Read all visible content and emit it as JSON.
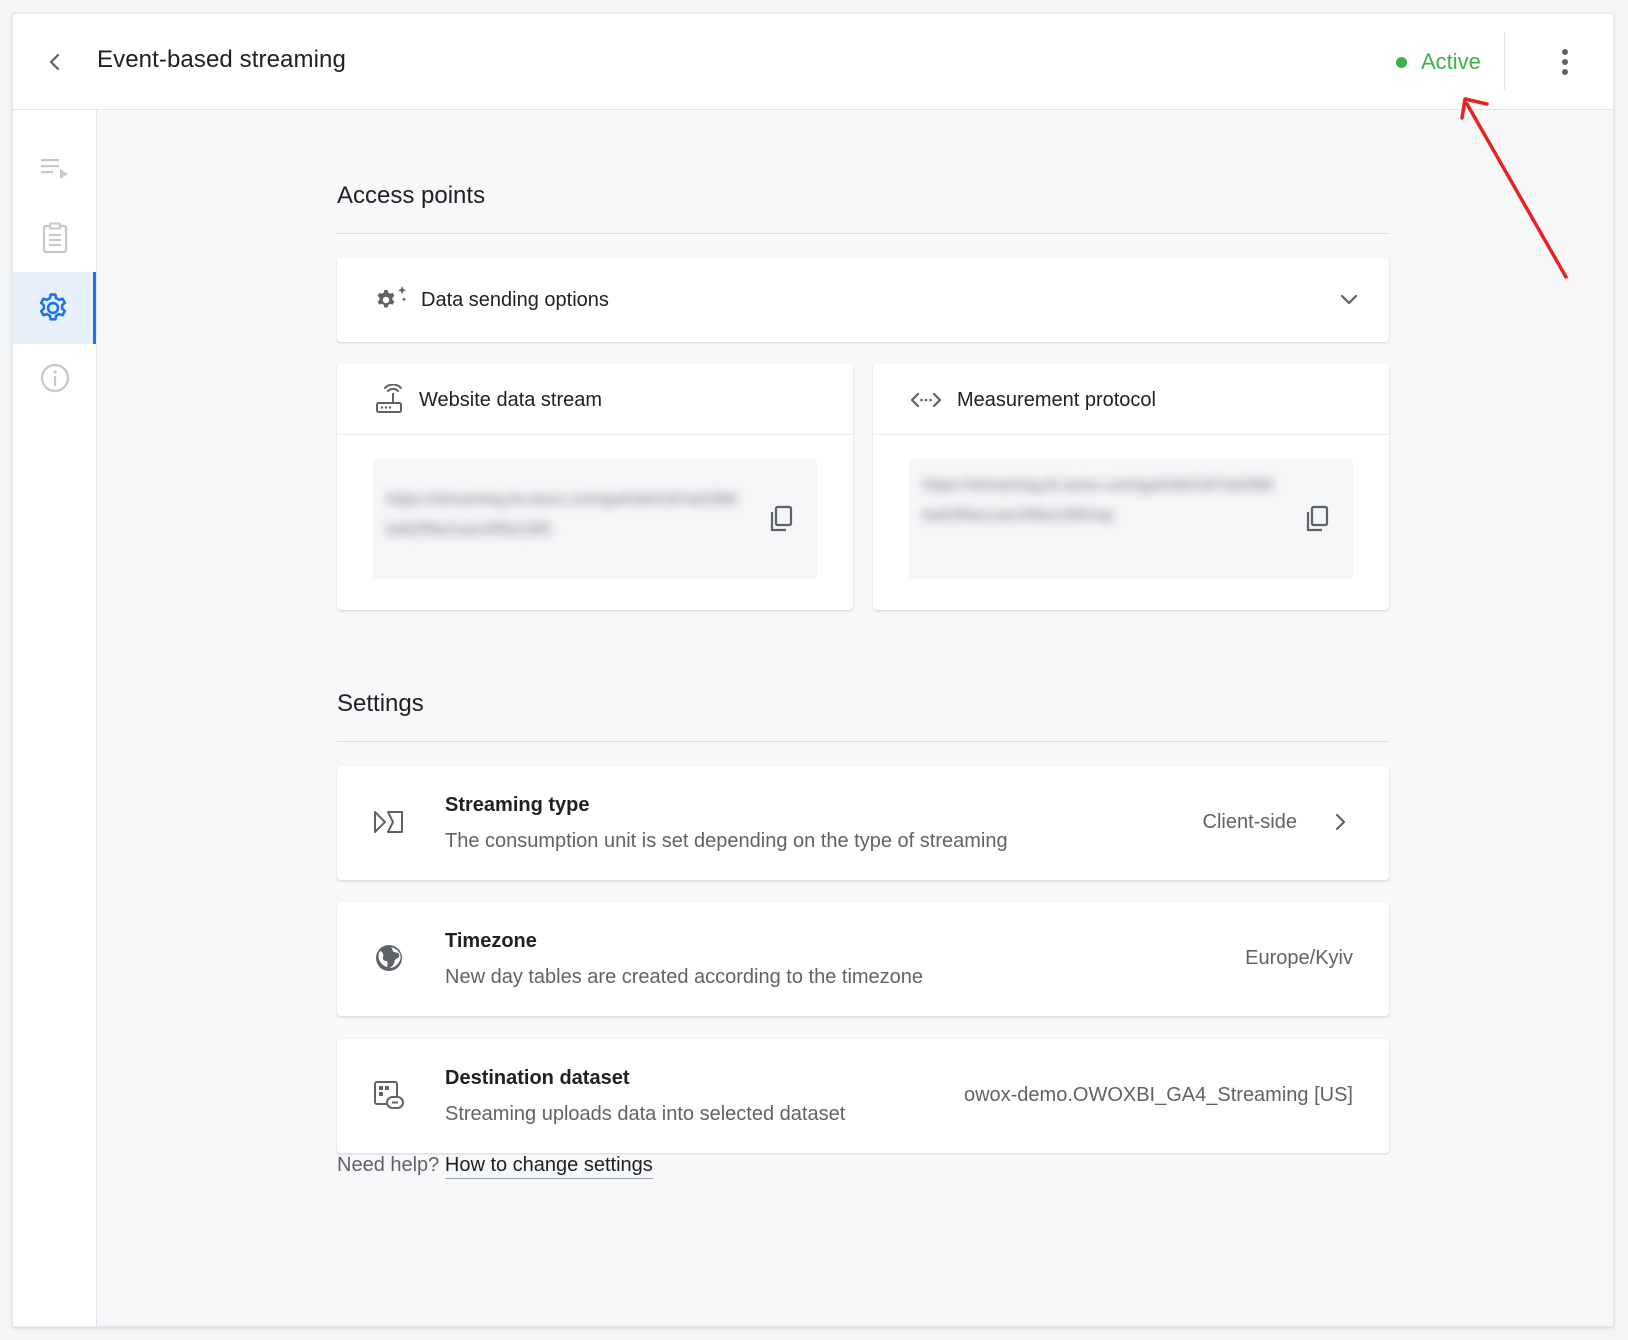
{
  "header": {
    "title": "Event-based streaming",
    "status_label": "Active",
    "back_icon": "chevron-left-icon",
    "more_icon": "more-vert-icon"
  },
  "sidebar": {
    "items": [
      {
        "name": "playlist",
        "icon": "playlist-play-icon",
        "active": false
      },
      {
        "name": "clipboard",
        "icon": "clipboard-icon",
        "active": false
      },
      {
        "name": "settings",
        "icon": "gear-icon",
        "active": true
      },
      {
        "name": "info",
        "icon": "info-icon",
        "active": false
      }
    ]
  },
  "access_points": {
    "title": "Access points",
    "options_label": "Data sending options",
    "website_stream": {
      "title": "Website data stream",
      "url": "https://streaming.bi.owox.com/ga4/de5187ad1fb8ba02f9a1cae1f0fa1285"
    },
    "measurement_protocol": {
      "title": "Measurement protocol",
      "url": "https://streaming.bi.owox.com/ga4/de5187ad1fb8ba02f9a1cae1f0fa1285/mp"
    }
  },
  "settings": {
    "title": "Settings",
    "items": [
      {
        "title": "Streaming type",
        "description": "The consumption unit is set depending on the type of streaming",
        "value": "Client-side"
      },
      {
        "title": "Timezone",
        "description": "New day tables are created according to the timezone",
        "value": "Europe/Kyiv"
      },
      {
        "title": "Destination dataset",
        "description": "Streaming uploads data into selected dataset",
        "value": "owox-demo.OWOXBI_GA4_Streaming [US]"
      }
    ]
  },
  "help": {
    "prefix": "Need help?",
    "link": "How to change settings"
  },
  "colors": {
    "accent": "#1a73e8",
    "status_active": "#3db24b",
    "annotation_arrow": "#e8231f"
  }
}
